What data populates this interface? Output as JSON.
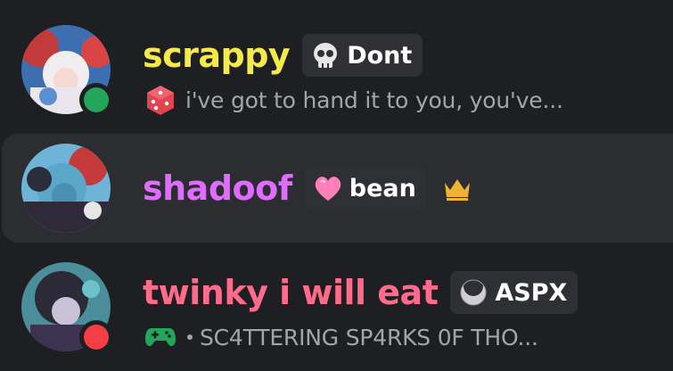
{
  "members": [
    {
      "username": "scrappy",
      "name_color": "#f5e94b",
      "tag_label": "Dont",
      "tag_icon": "skull-icon",
      "status": "online",
      "status_color": "#23a55a",
      "activity_icon": "dice-icon",
      "activity_text": "i've got to hand it to you, you've..."
    },
    {
      "username": "shadoof",
      "name_color": "#e06cff",
      "tag_label": "bean",
      "tag_icon": "heart-icon",
      "owner_icon": "crown-icon"
    },
    {
      "username": "twinky i will eat",
      "name_color": "#ff6b8a",
      "tag_label": "ASPX",
      "tag_icon": "crescent-moon-icon",
      "status": "do-not-disturb",
      "status_color": "#f23f43",
      "activity_icon": "gamepad-icon",
      "activity_text": "SC4TTERING SP4RKS 0F THO..."
    }
  ]
}
